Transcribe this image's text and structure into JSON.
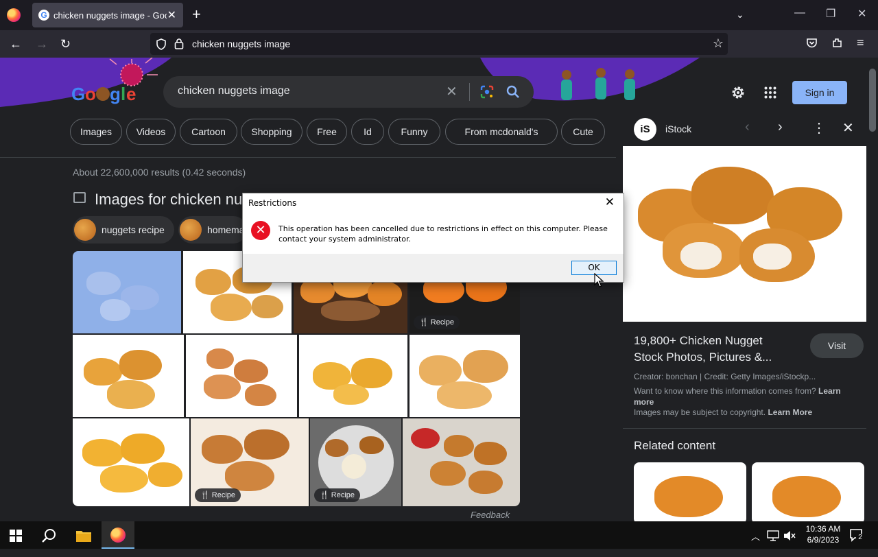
{
  "browser": {
    "tab_title": "chicken nuggets image - Goog",
    "url": "chicken nuggets image"
  },
  "google": {
    "search_query": "chicken nuggets image",
    "sign_in": "Sign in",
    "chips": [
      "Images",
      "Videos",
      "Cartoon",
      "Shopping",
      "Free",
      "Id",
      "Funny",
      "From mcdonald's",
      "Cute"
    ],
    "result_stats": "About 22,600,000 results (0.42 seconds)",
    "images_heading": "Images for chicken nu",
    "suggestions": [
      "nuggets recipe",
      "homema"
    ],
    "recipe_label": "Recipe",
    "feedback": "Feedback"
  },
  "panel": {
    "source": "iStock",
    "caption": "19,800+ Chicken Nugget Stock Photos, Pictures &...",
    "visit": "Visit",
    "creator": "Creator: bonchan | Credit: Getty Images/iStockp...",
    "info_text": "Want to know where this information comes from?",
    "learn_more_1": "Learn more",
    "copyright": "Images may be subject to copyright.",
    "learn_more_2": "Learn More",
    "related": "Related content"
  },
  "dialog": {
    "title": "Restrictions",
    "message": "This operation has been cancelled due to restrictions in effect on this computer. Please contact your system administrator.",
    "ok": "OK"
  },
  "taskbar": {
    "time": "10:36 AM",
    "date": "6/9/2023",
    "notifications": "2"
  },
  "colors": {
    "accent": "#8ab4f8",
    "page_bg": "#202124",
    "error": "#e81123"
  }
}
